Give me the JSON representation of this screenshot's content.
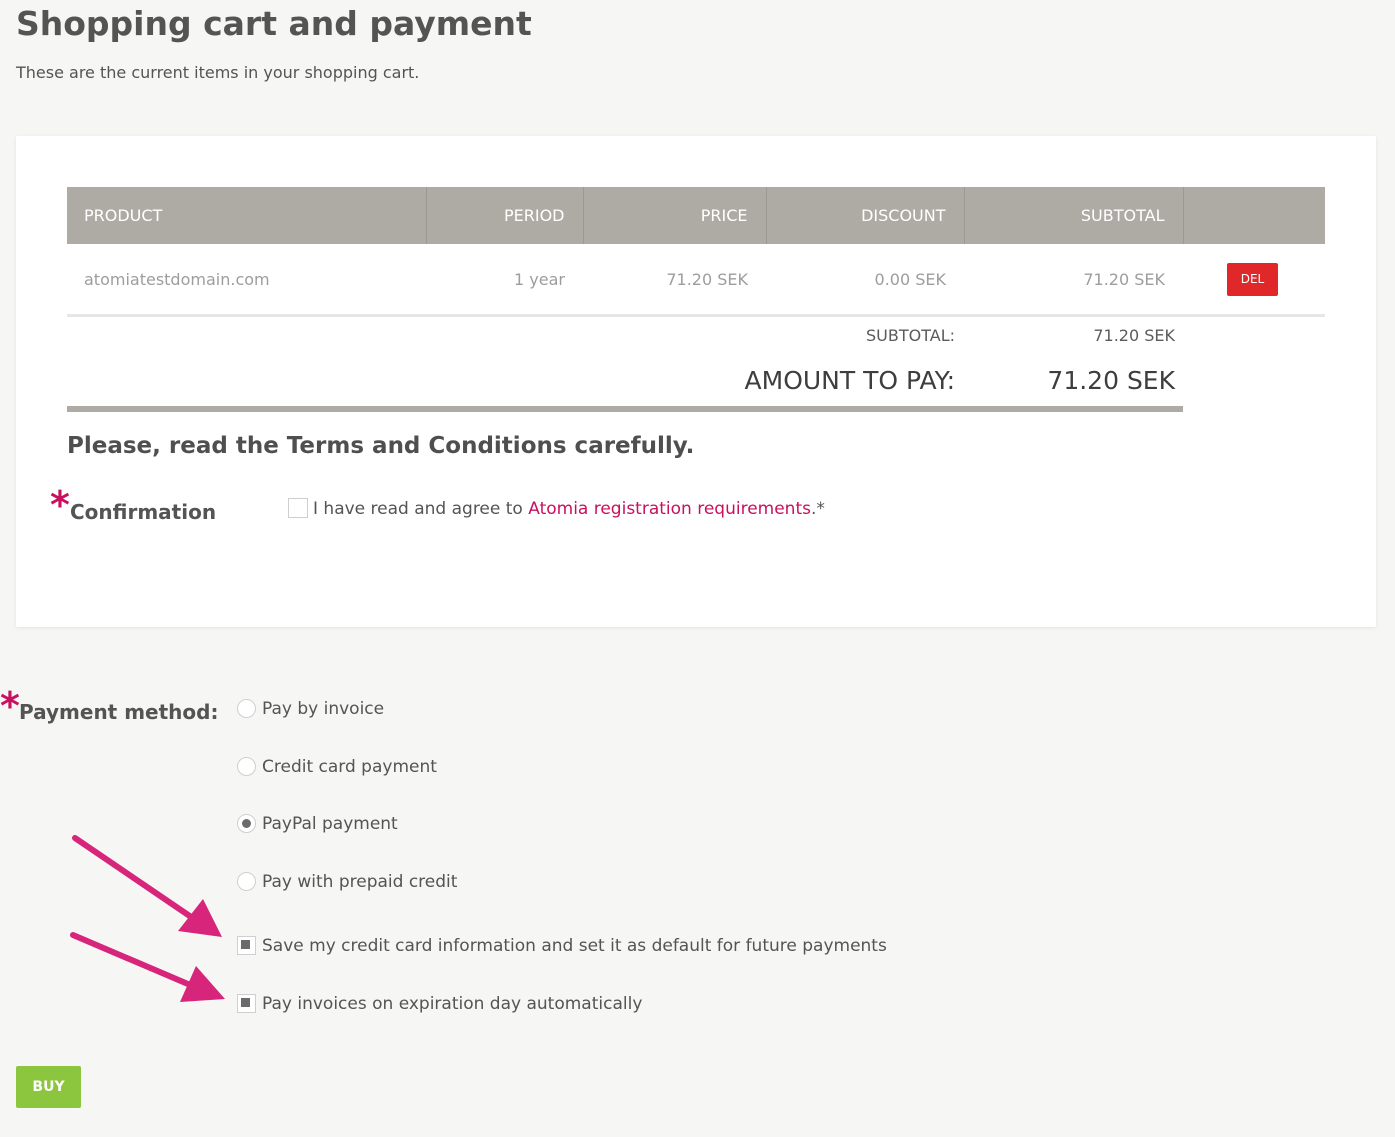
{
  "page": {
    "title": "Shopping cart and payment",
    "intro": "These are the current items in your shopping cart."
  },
  "cart": {
    "columns": [
      "PRODUCT",
      "PERIOD",
      "PRICE",
      "DISCOUNT",
      "SUBTOTAL",
      ""
    ],
    "rows": [
      {
        "product": "atomiatestdomain.com",
        "period": "1 year",
        "price": "71.20 SEK",
        "discount": "0.00 SEK",
        "subtotal": "71.20 SEK",
        "delete_label": "DEL"
      }
    ],
    "subtotal_label": "SUBTOTAL:",
    "subtotal_value": "71.20 SEK",
    "amount_label": "AMOUNT TO PAY:",
    "amount_value": "71.20 SEK"
  },
  "terms": {
    "heading": "Please, read the Terms and Conditions carefully.",
    "required_mark": "*",
    "confirmation_label": "Confirmation",
    "agree_prefix": "I have read and agree to ",
    "agree_link": "Atomia registration requirements",
    "agree_suffix": ".*",
    "agreed": false
  },
  "payment": {
    "required_mark": "*",
    "label": "Payment method:",
    "options": [
      {
        "label": "Pay by invoice",
        "selected": false
      },
      {
        "label": "Credit card payment",
        "selected": false
      },
      {
        "label": "PayPal payment",
        "selected": true
      },
      {
        "label": "Pay with prepaid credit",
        "selected": false
      }
    ],
    "save_card_label": "Save my credit card information and set it as default for future payments",
    "save_card_checked": true,
    "auto_pay_label": "Pay invoices on expiration day automatically",
    "auto_pay_checked": true
  },
  "buy_label": "BUY",
  "colors": {
    "accent": "#c8105f",
    "delete": "#e0282a",
    "buy": "#8cc63f",
    "table_header": "#aeaba5",
    "background": "#f6f6f4"
  }
}
